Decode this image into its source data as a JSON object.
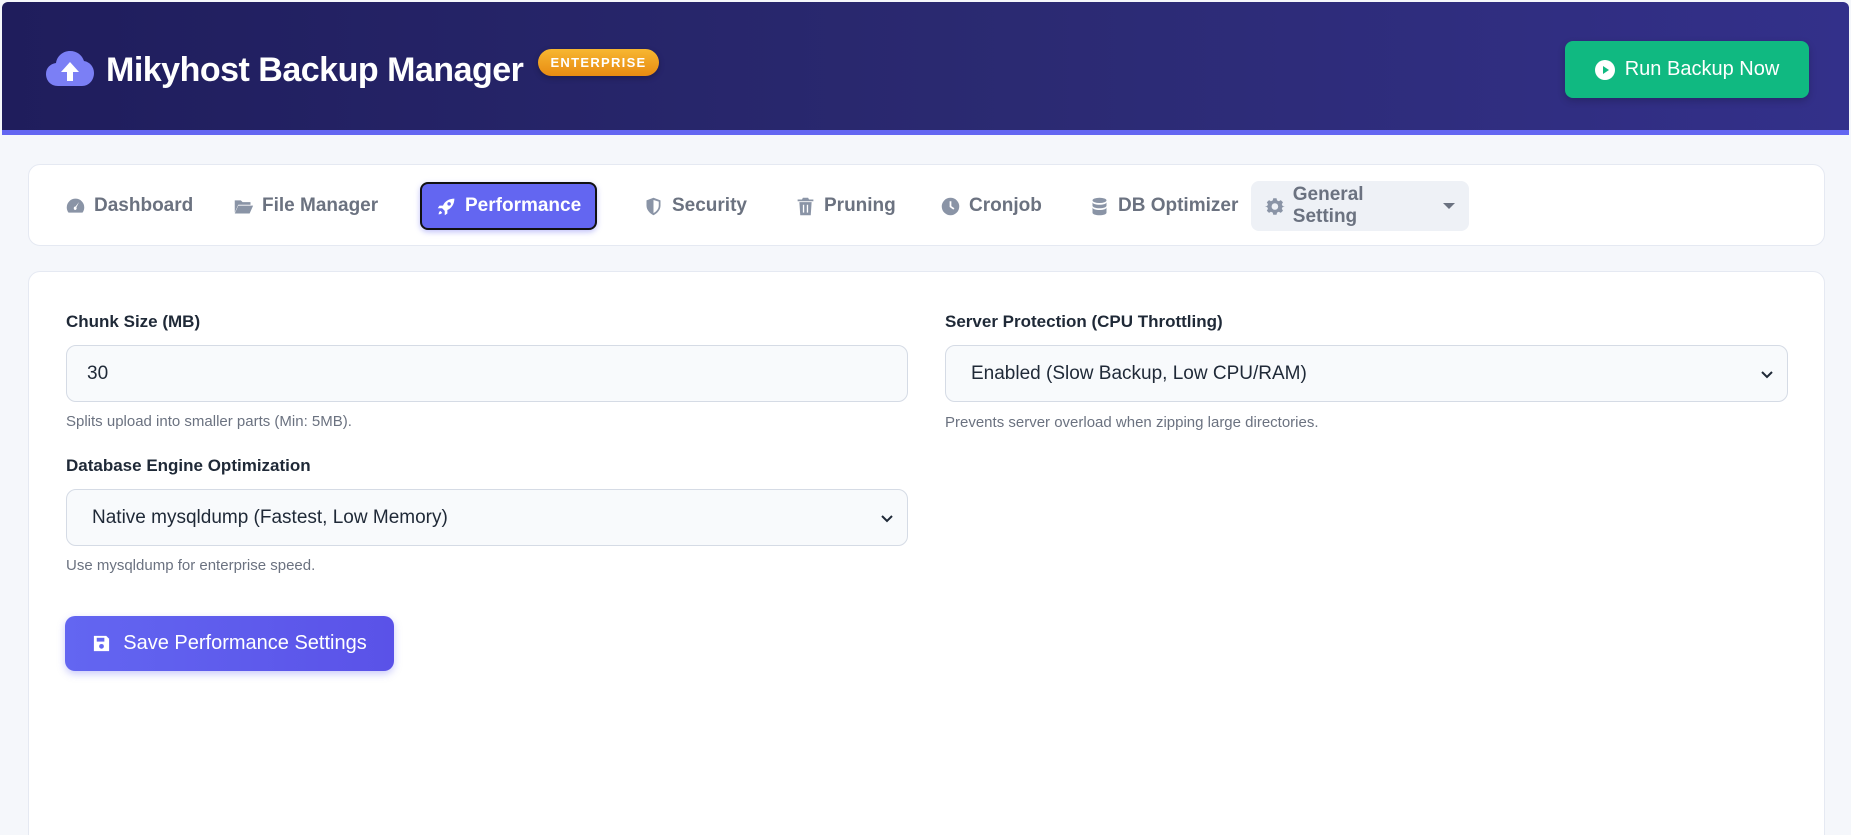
{
  "header": {
    "title": "Mikyhost Backup Manager",
    "badge": "ENTERPRISE",
    "brand_icon": "cloud-upload-icon",
    "run_button": "Run Backup Now"
  },
  "nav": {
    "items": [
      {
        "label": "Dashboard",
        "icon": "gauge-icon"
      },
      {
        "label": "File Manager",
        "icon": "folder-open-icon"
      },
      {
        "label": "Performance",
        "icon": "rocket-icon",
        "active": true
      },
      {
        "label": "Security",
        "icon": "shield-icon"
      },
      {
        "label": "Pruning",
        "icon": "trash-icon"
      },
      {
        "label": "Cronjob",
        "icon": "clock-icon"
      },
      {
        "label": "DB Optimizer",
        "icon": "database-icon"
      },
      {
        "label": "General Setting",
        "icon": "gear-icon",
        "dropdown": true
      }
    ]
  },
  "form": {
    "chunk_size": {
      "label": "Chunk Size (MB)",
      "value": "30",
      "help": "Splits upload into smaller parts (Min: 5MB)."
    },
    "server_protection": {
      "label": "Server Protection (CPU Throttling)",
      "selected": "Enabled (Slow Backup, Low CPU/RAM)",
      "help": "Prevents server overload when zipping large directories."
    },
    "db_engine": {
      "label": "Database Engine Optimization",
      "selected": "Native mysqldump (Fastest, Low Memory)",
      "help": "Use mysqldump for enterprise speed."
    },
    "save_button": "Save Performance Settings"
  },
  "colors": {
    "accent": "#6366f1",
    "success": "#10b981",
    "header_bg": "#1f1d5c",
    "badge": "#f0a020"
  }
}
